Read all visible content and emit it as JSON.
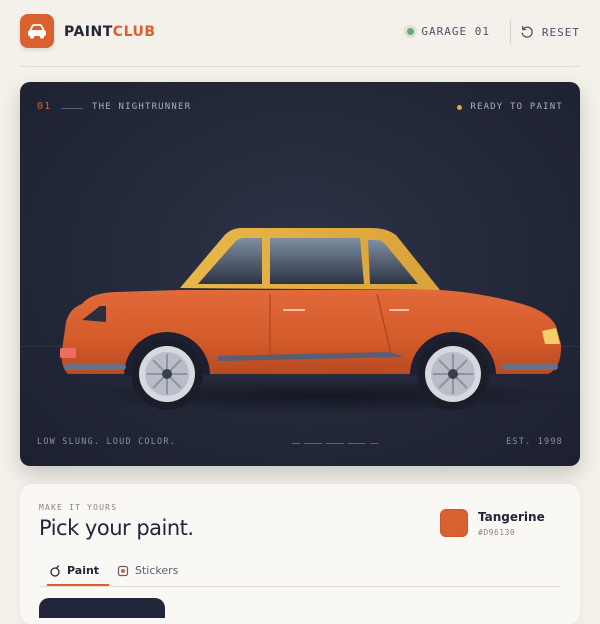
{
  "app": {
    "brand_a": "PAINT",
    "brand_b": "CLUB",
    "garage_label": "GARAGE 01",
    "reset_label": "RESET"
  },
  "hero": {
    "number": "01",
    "car_name": "THE NIGHTRUNNER",
    "status": "READY TO PAINT",
    "tagline": "LOW SLUNG. LOUD COLOR.",
    "established": "EST. 1998",
    "car_color": "#d96130",
    "roof_color": "#e8b84a"
  },
  "panel": {
    "kicker": "MAKE IT YOURS",
    "title": "Pick your paint.",
    "color_name": "Tangerine",
    "color_hex": "#D96130",
    "tabs": [
      {
        "label": "Paint",
        "icon": "paint-drop-icon",
        "active": true
      },
      {
        "label": "Stickers",
        "icon": "sticker-icon",
        "active": false
      }
    ]
  },
  "colors": {
    "accent": "#d96130",
    "status_dot": "#6aa876",
    "hero_bg": "#232839"
  }
}
